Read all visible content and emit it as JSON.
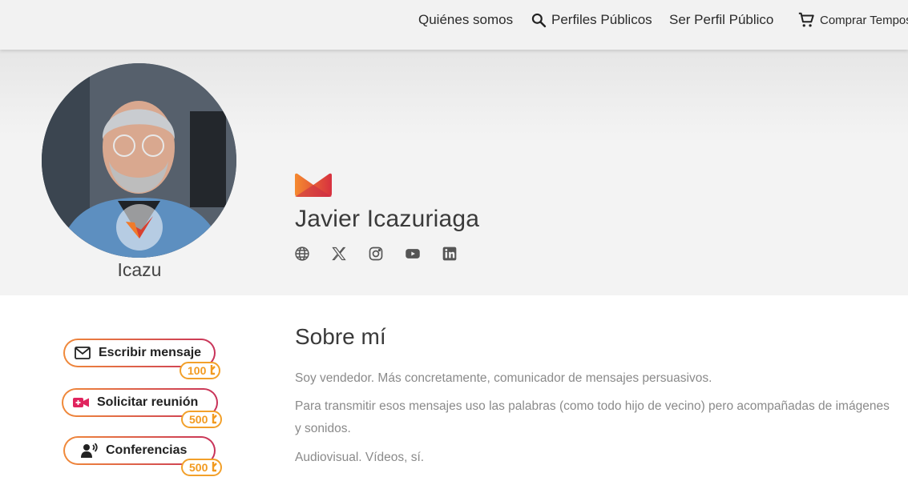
{
  "nav": {
    "about": "Quiénes somos",
    "profiles": "Perfiles Públicos",
    "become": "Ser Perfil Público",
    "buy": "Comprar Tempos"
  },
  "profile": {
    "nickname": "Icazu",
    "full_name": "Javier Icazuriaga",
    "socials": [
      "globe-icon",
      "x-icon",
      "instagram-icon",
      "youtube-icon",
      "linkedin-icon"
    ]
  },
  "actions": [
    {
      "label": "Escribir mensaje",
      "price": "100",
      "icon": "mail-icon"
    },
    {
      "label": "Solicitar reunión",
      "price": "500",
      "icon": "video-icon"
    },
    {
      "label": "Conferencias",
      "price": "500",
      "icon": "speaker-icon"
    }
  ],
  "about": {
    "title": "Sobre mí",
    "paragraphs": [
      "Soy vendedor. Más concretamente, comunicador de mensajes persuasivos.",
      "Para transmitir esos mensajes uso las palabras (como todo hijo de vecino) pero acompañadas de imágenes",
      "y sonidos.",
      "Audiovisual. Vídeos, sí."
    ]
  },
  "colors": {
    "accent_start": "#f08a3a",
    "accent_end": "#c8325a",
    "coin": "#f29a1f"
  }
}
